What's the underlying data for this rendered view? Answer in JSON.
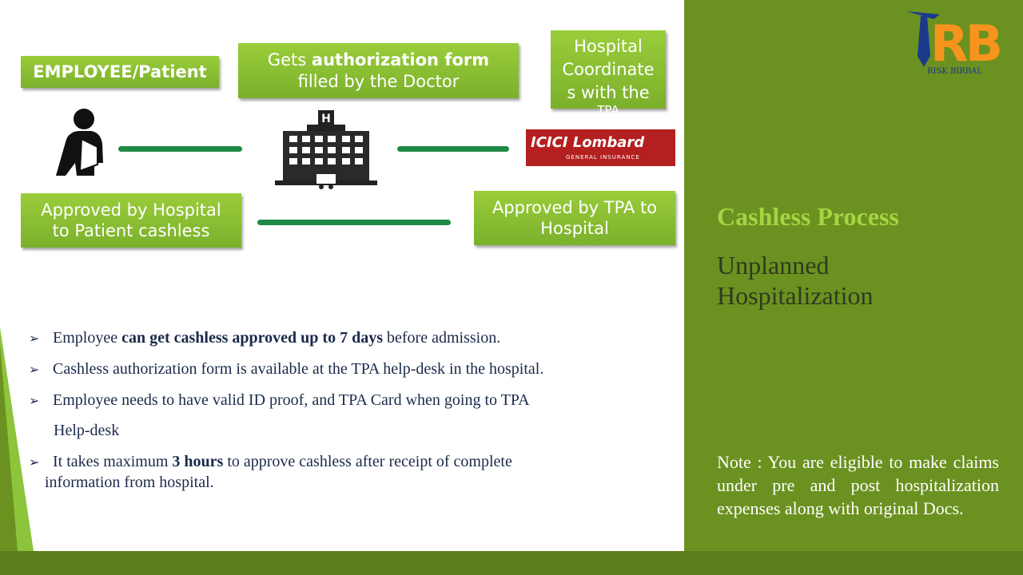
{
  "flow": {
    "employee_box": "EMPLOYEE/Patient",
    "doctor_box": {
      "prefix": "Gets ",
      "bold": "authorization form",
      "suffix": "filled by the Doctor"
    },
    "tpa_box": {
      "line1": "Hospital",
      "line2": "Coordinate",
      "line3": "s  with the",
      "line4": "TPA"
    },
    "hospital_approved_box": {
      "line1": "Approved  by Hospital",
      "line2": "to Patient cashless"
    },
    "tpa_approved_box": {
      "line1": "Approved  by TPA to",
      "line2": "Hospital"
    },
    "hospital_icon_letter": "H",
    "insurer_logo": {
      "name": "ICICI Lombard",
      "tagline": "GENERAL INSURANCE"
    }
  },
  "bullets": [
    {
      "before": "Employee ",
      "bold": "can get cashless approved up to 7 days",
      "after": " before admission."
    },
    {
      "before": "Cashless authorization  form is available at the TPA help-desk in the hospital.",
      "bold": "",
      "after": ""
    },
    {
      "before": "Employee needs to have valid ID proof, and TPA Card when going to TPA",
      "bold": "",
      "after": "",
      "continuation": "Help-desk"
    },
    {
      "before": "It takes maximum ",
      "bold": "3 hours",
      "after": " to approve cashless after receipt of complete",
      "continuation": "information  from hospital."
    }
  ],
  "sidebar": {
    "title": "Cashless Process",
    "subtitle_line1": "Unplanned",
    "subtitle_line2": "Hospitalization",
    "note": "Note : You are eligible to make claims under pre and post hospitalization expenses along with original Docs."
  },
  "logo": {
    "letters": "RB",
    "text": "RISK BIRBAL"
  },
  "colors": {
    "right_panel": "#6b9120",
    "box_green": "#8cc43a",
    "connector": "#1f8a45",
    "title_green": "#a6d343",
    "insurer_red": "#b3201f"
  }
}
